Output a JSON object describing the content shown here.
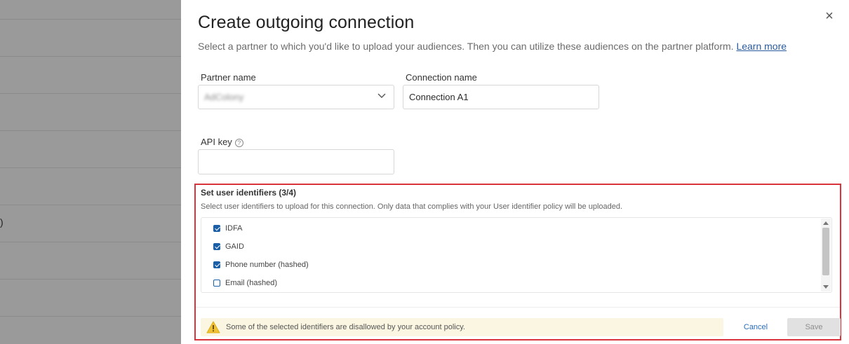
{
  "background": {
    "glyph": ")"
  },
  "dialog": {
    "title": "Create outgoing connection",
    "subtitle": "Select a partner to which you'd like to upload your audiences. Then you can utilize these audiences on the partner platform.",
    "learn_more": "Learn more",
    "close_icon": "×"
  },
  "form": {
    "partner_name_label": "Partner name",
    "partner_name_value": "AdColony",
    "connection_name_label": "Connection name",
    "connection_name_value": "Connection A1",
    "api_key_label": "API key",
    "api_key_help_icon": "?",
    "api_key_value": ""
  },
  "identifiers": {
    "title": "Set user identifiers (3/4)",
    "description": "Select user identifiers to upload for this connection. Only data that complies with your User identifier policy will be uploaded.",
    "items": [
      {
        "label": "IDFA",
        "checked": true
      },
      {
        "label": "GAID",
        "checked": true
      },
      {
        "label": "Phone number (hashed)",
        "checked": true
      },
      {
        "label": "Email (hashed)",
        "checked": false
      }
    ]
  },
  "footer": {
    "warning": "Some of the selected identifiers are disallowed by your account policy.",
    "cancel": "Cancel",
    "save": "Save"
  },
  "colors": {
    "accent": "#1d5fa6",
    "highlight_border": "#d9343b",
    "warning_bg": "#fbf6e2",
    "warning_icon": "#f0c233"
  }
}
